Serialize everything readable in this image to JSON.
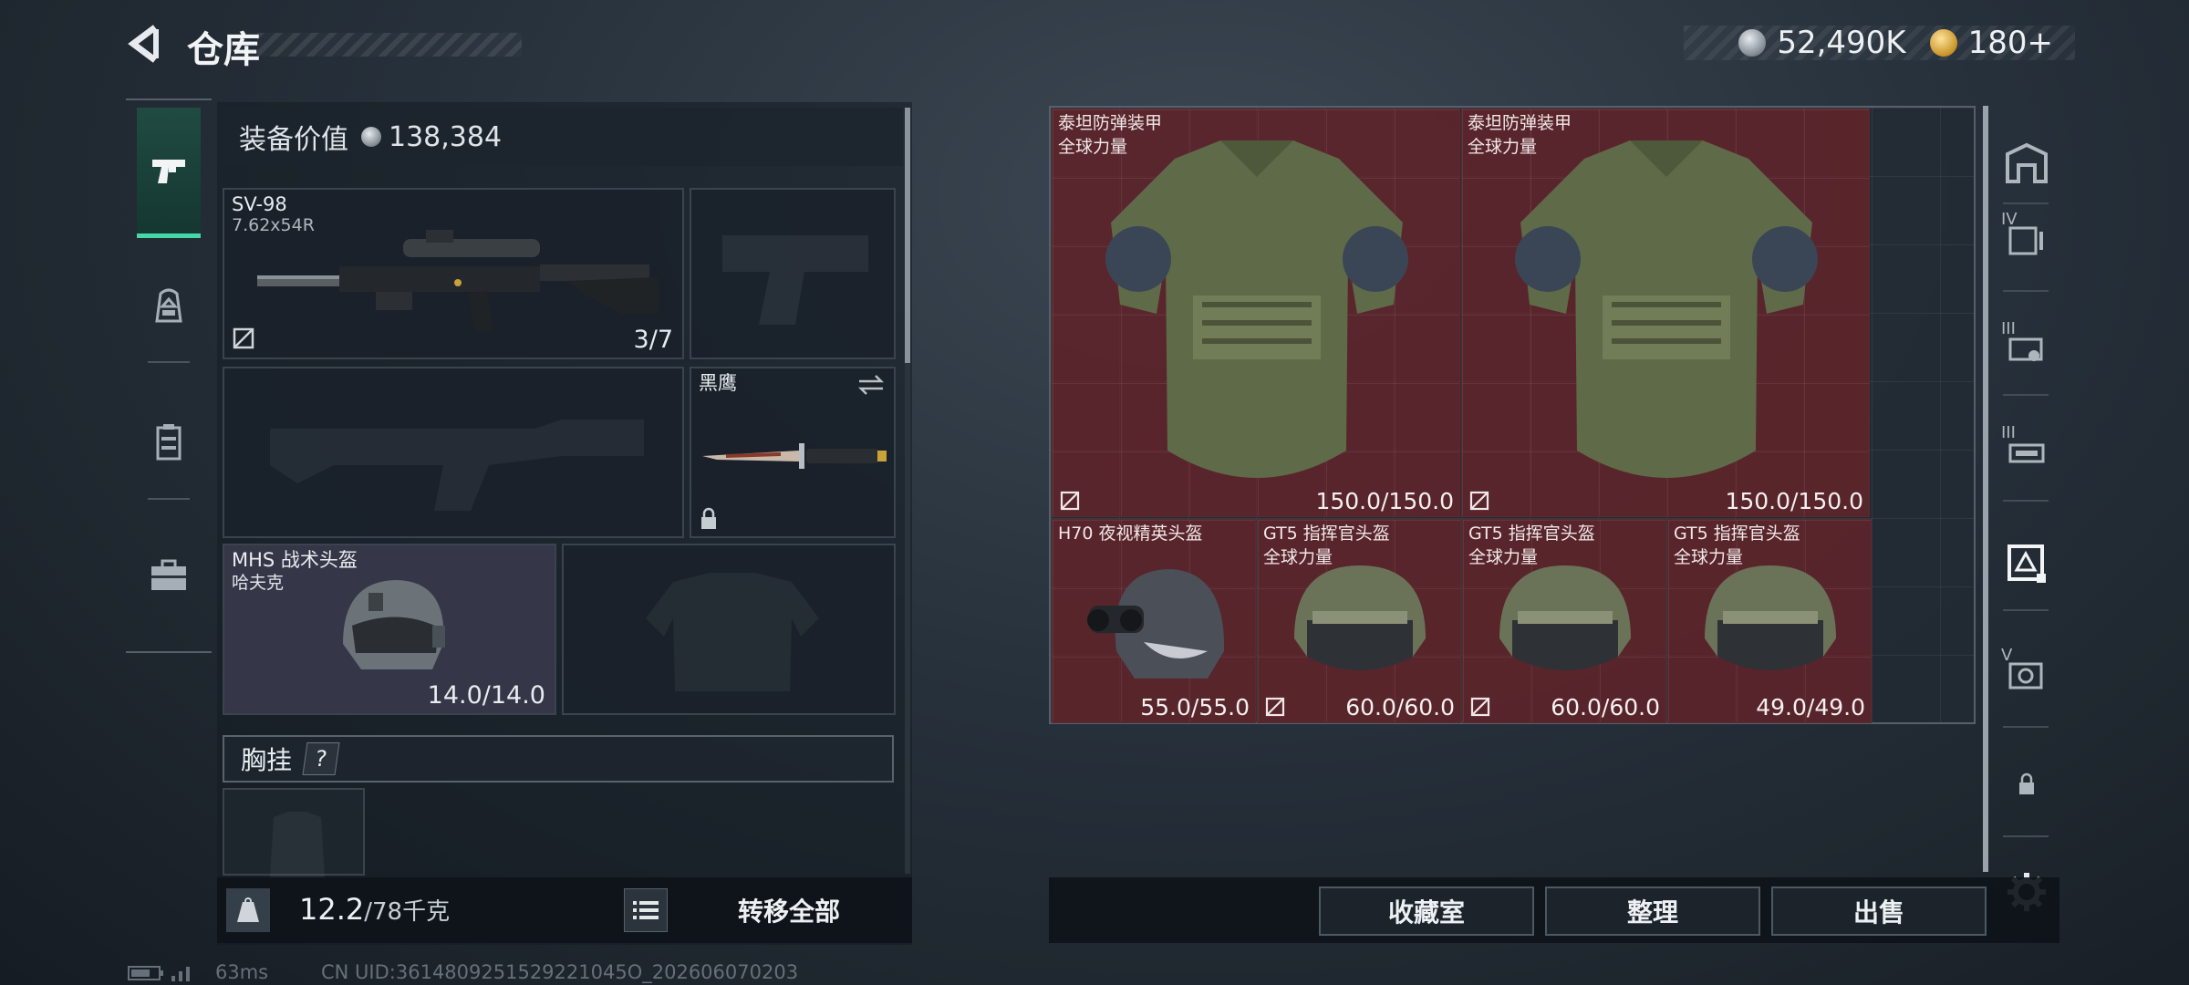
{
  "header": {
    "title": "仓库",
    "silver_amount": "52,490K",
    "gold_amount": "180+"
  },
  "loadout": {
    "value_label": "装备价值",
    "value_amount": "138,384",
    "primary": {
      "name": "SV-98",
      "ammo": "7.62x54R",
      "count": "3/7"
    },
    "melee": {
      "name": "黑鹰"
    },
    "helmet": {
      "name": "MHS 战术头盔",
      "sub": "哈夫克",
      "durability": "14.0/14.0"
    },
    "vest_header": "胸挂",
    "help_label": "?",
    "weight_current": "12.2",
    "weight_capacity": "/78千克",
    "kg_label": "KG",
    "transfer_all": "转移全部"
  },
  "stash_items": [
    {
      "name": "泰坦防弹装甲",
      "sub": "全球力量",
      "durability": "150.0/150.0"
    },
    {
      "name": "泰坦防弹装甲",
      "sub": "全球力量",
      "durability": "150.0/150.0"
    },
    {
      "name": "H70 夜视精英头盔",
      "sub": "",
      "durability": "55.0/55.0"
    },
    {
      "name": "GT5 指挥官头盔",
      "sub": "全球力量",
      "durability": "60.0/60.0"
    },
    {
      "name": "GT5 指挥官头盔",
      "sub": "全球力量",
      "durability": "60.0/60.0"
    },
    {
      "name": "GT5 指挥官头盔",
      "sub": "全球力量",
      "durability": "49.0/49.0"
    }
  ],
  "right_sidebar": {
    "tier_labels": [
      "IV",
      "III",
      "III",
      "V"
    ]
  },
  "actions": {
    "collection": "收藏室",
    "sort": "整理",
    "sell": "出售"
  },
  "status_bar": {
    "ping": "63ms",
    "uid": "CN UID:3614809251529221045O_202606070203"
  },
  "icons": [
    "back-icon",
    "silver-coin-icon",
    "gold-coin-icon",
    "pistol-icon",
    "backpack-icon",
    "vest-icon",
    "case-icon",
    "no-insure-icon",
    "swap-icon",
    "lock-icon",
    "list-icon",
    "kg-icon",
    "helmet-tab-icon",
    "gear-icon",
    "battery-icon",
    "signal-icon"
  ],
  "colors": {
    "accent": "#46d6a8",
    "item_bg": "#6e2228",
    "panel": "#141b23"
  }
}
